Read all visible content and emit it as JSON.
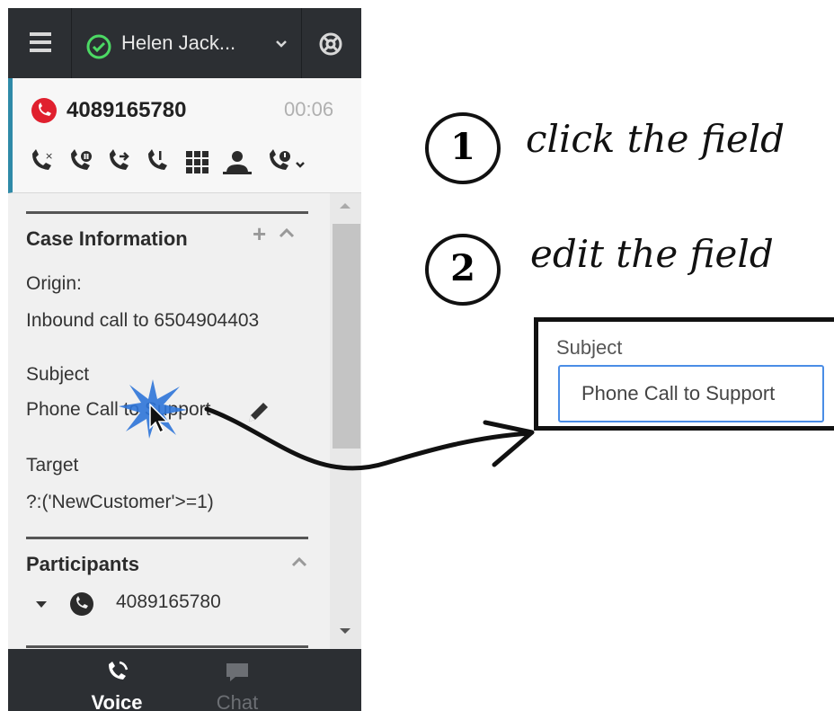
{
  "topbar": {
    "agent_name": "Helen Jack...",
    "status_color": "#4cd964"
  },
  "call": {
    "number": "4089165780",
    "timer": "00:06",
    "controls": [
      "end-call-icon",
      "hold-icon",
      "transfer-icon",
      "consult-icon",
      "keypad-icon",
      "conference-icon",
      "schedule-callback-icon"
    ]
  },
  "case": {
    "title": "Case Information",
    "origin_label": "Origin:",
    "origin_value": "Inbound call to 6504904403",
    "subject_label": "Subject",
    "subject_value": "Phone Call to Support",
    "target_label": "Target",
    "target_value": "?:('NewCustomer'>=1)"
  },
  "participants": {
    "title": "Participants",
    "items": [
      {
        "number": "4089165780"
      }
    ]
  },
  "tabs": {
    "voice": "Voice",
    "chat": "Chat"
  },
  "annotations": {
    "step1_number": "1",
    "step1_text": "click the field",
    "step2_number": "2",
    "step2_text": "edit the field"
  },
  "zoom_field": {
    "label": "Subject",
    "value": "Phone Call to Support"
  },
  "colors": {
    "accent": "#2f8aa8",
    "focus": "#4a8de6",
    "call_red": "#e0202e"
  }
}
